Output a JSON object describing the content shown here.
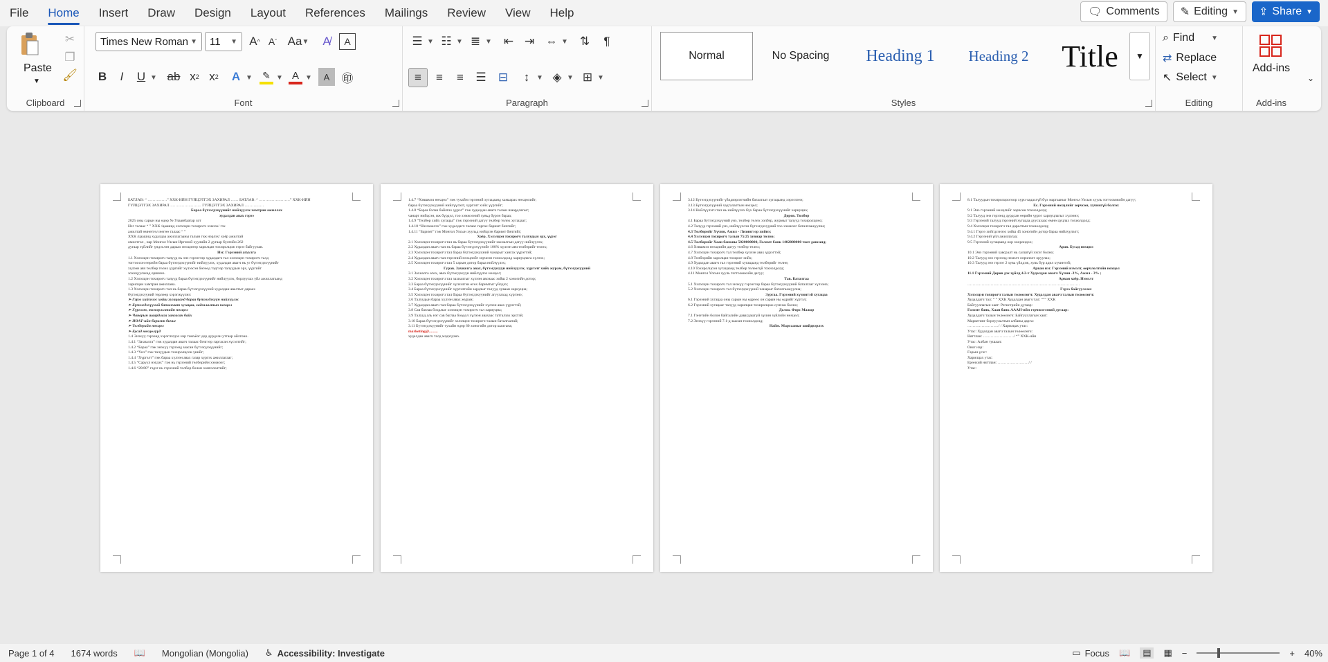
{
  "menu": [
    "File",
    "Home",
    "Insert",
    "Draw",
    "Design",
    "Layout",
    "References",
    "Mailings",
    "Review",
    "View",
    "Help"
  ],
  "active_menu": "Home",
  "top_right": {
    "comments": "Comments",
    "editing": "Editing",
    "share": "Share"
  },
  "ribbon": {
    "clipboard": {
      "label": "Clipboard",
      "paste": "Paste"
    },
    "font": {
      "label": "Font",
      "font_name": "Times New Roman",
      "font_size": "11"
    },
    "paragraph": {
      "label": "Paragraph"
    },
    "styles": {
      "label": "Styles",
      "items": [
        "Normal",
        "No Spacing",
        "Heading 1",
        "Heading 2",
        "Title"
      ]
    },
    "editing": {
      "label": "Editing",
      "find": "Find",
      "replace": "Replace",
      "select": "Select"
    },
    "addins": {
      "label": "Add-ins",
      "button": "Add-ins"
    }
  },
  "pages": [
    {
      "lines": [
        {
          "t": "БАТЛАВ: “ ……………” ХХК-ИЙН ГҮЙЦЭТГЭХ ЗАХИРАЛ ……          БАТЛАВ: “ ……………………” ХХК-ИЙН",
          "c": ""
        },
        {
          "t": "ГҮЙЦЭТГЭХ ЗАХИРАЛ ……………………          ГҮЙЦЭТГЭХ ЗАХИРАЛ ……………",
          "c": ""
        },
        {
          "t": " ",
          "c": ""
        },
        {
          "t": " ",
          "c": ""
        },
        {
          "t": " ",
          "c": ""
        },
        {
          "t": "Бараа бүтээгдэхүүнийг нийлүүлэх хамтран ажиллах",
          "c": "center"
        },
        {
          "t": "худалдан авах гэрээ",
          "c": "center"
        },
        {
          "t": " ",
          "c": ""
        },
        {
          "t": "2025 оны    сарын    ны өдөр                    №                    Улаанбаатар хот",
          "c": ""
        },
        {
          "t": " ",
          "c": ""
        },
        {
          "t": "Нэг талаас “          ” ХХК /цаашид хэлэлцэн тохирогч хэмээх/ гэх                  ",
          "c": ""
        },
        {
          "t": "ажилтай          өмнөтгөл          нөгөө талаас “                ”",
          "c": ""
        },
        {
          "t": "ХХК /цаашид худалдаа ажиллагааны талын гэж нэрлэх/ хоёр                    ажилтай",
          "c": ""
        },
        {
          "t": "өмнөтгөл ,          нар Монгол Улсын Иргэний хуулийн 2 дугаар бүлгийн 262",
          "c": ""
        },
        {
          "t": "дугаар зүйлийг үндэслэн дараах нөхцлөөр харилцан тохиролцож гэрээ байгуулав.",
          "c": ""
        },
        {
          "t": "Нэг. Гэрээний агуулга",
          "c": "center"
        },
        {
          "t": "1.1 Хэлэлцэн тохирогч талууд нь энэ гэрээгээр худалдагч тал хэлэлцэн тохирогч талд",
          "c": ""
        },
        {
          "t": "тогтоосон өөрийн бараа бүтээгдэхүүнийг нийлүүлэх, худалдан авагч нь уг бүтээгдэхүүнийг",
          "c": ""
        },
        {
          "t": "хүлээн авч төлбөр төлөх үүргийг хүлээсэн бөгөөд тэдгээр талуудын эрх, үүргийг",
          "c": ""
        },
        {
          "t": "зохицуулахад оршино.",
          "c": ""
        },
        {
          "t": "1.2 Хэлэлцэн тохирогч талууд бараа бүтээгдэхүүнийг нийлүүлэх, борлуулах үйл ажиллагаанд",
          "c": ""
        },
        {
          "t": "харилцан хамтран ажиллана.",
          "c": ""
        },
        {
          "t": "1.3 Хэлэлцэн тохирогч тал нь бараа бүтээгдэхүүний худалдан авалтыг дараах",
          "c": ""
        },
        {
          "t": "бүтээгдэхүүний төрлөөр хэрэгжүүлнэ:",
          "c": ""
        },
        {
          "t": "➢ Гэрээ хийснээс хойш хугацаанд бараа бүтээгдэхүүн нийлүүлэх",
          "c": "italic"
        },
        {
          "t": "➢ Бүтээгдэхүүний баталгаат хугацаа, хадгалалтын нөхцөл",
          "c": "italic"
        },
        {
          "t": "➢ Хүргэлт, тээвэрлэлтийн нөхцөл",
          "c": "italic"
        },
        {
          "t": "➢ Чанарын шаардлага хангасан байх",
          "c": "italic"
        },
        {
          "t": "➢ НӨАТ-ийн баримт бичиг",
          "c": "italic"
        },
        {
          "t": "➢ Төлбөрийн нөхцөл",
          "c": "italic"
        },
        {
          "t": "➢ Бусад нөхцөлүүд",
          "c": "italic"
        },
        {
          "t": "1.4 Энэхүү гэрээнд хэрэглэгдэх нэр томъёог дор дурдсан утгаар ойлгоно.",
          "c": ""
        },
        {
          "t": "1.4.1 “Захиалга” гэж худалдан авагч талаас бичгээр гаргасан хүсэлтийг;",
          "c": ""
        },
        {
          "t": "1.4.2 “Бараа” гэж энэхүү гэрээнд заасан бүтээгдэхүүнийг;",
          "c": ""
        },
        {
          "t": "1.4.3 “Үнэ” гэж талуудын тохиролцсон үнийг;",
          "c": ""
        },
        {
          "t": "1.4.4 “Хүргэлт” гэж бараа хүлээн авах газар хүргэх ажиллагааг;",
          "c": ""
        },
        {
          "t": "1.4.5 “Саруул нэгдэх” гэж нь гэрээний төлбөрийн хэмжээг;",
          "c": ""
        },
        {
          "t": "1.4.6 “20/80” гэдэг нь гэрээний төлбөр болон хөнгөлөлтийг;",
          "c": ""
        }
      ]
    },
    {
      "lines": [
        {
          "t": "1.4.7 “Хэвшмэл нөхцөл” гэж тухайн гэрээний хугацаанд хамаарах нөхцөлийг;",
          "c": ""
        },
        {
          "t": "бараа бүтээгдэхүүний нийлүүлэлт, хүргэлт хийх үүргийг;",
          "c": ""
        },
        {
          "t": "1.4.8 “Бараа бэлэн байлгах үүрэг” гэж худалдан авагч талын шаардлагыг;",
          "c": ""
        },
        {
          "t": "чанарт нийцсэн, иж бүрдэл, тоо хэмжээний хувьд бүрэн бараа;",
          "c": ""
        },
        {
          "t": "1.4.9 “Төлбөр хийх хугацаа” гэж гэрээний дагуу төлбөр төлөх хугацааг;",
          "c": ""
        },
        {
          "t": "1.4.10 “Нэхэмжлэх” гэж худалдагч талаас гаргах баримт бичгийг;",
          "c": ""
        },
        {
          "t": "1.4.11 “Баримт” гэж Монгол Улсын хуульд нийцсэн баримт бичгийг;",
          "c": ""
        },
        {
          "t": "Хоёр. Хэлэлцэн тохирогч талуудын эрх, үүрэг",
          "c": "center"
        },
        {
          "t": "2.1 Хэлэлцэн тохирогч тал нь бараа бүтээгдэхүүнийг захиалгын дагуу нийлүүлэх;",
          "c": ""
        },
        {
          "t": "2.2 Худалдан авагч тал нь бараа бүтээгдэхүүнийг 100% хүлээн авч төлбөрийг төлөх;",
          "c": ""
        },
        {
          "t": "2.3 Хэлэлцэн тохирогч тал бараа бүтээгдэхүүний чанарыг хангах үүрэгтэй;",
          "c": ""
        },
        {
          "t": "2.4 Худалдан авагч тал гэрээний нөхцлийг зөрчсөн тохиолдолд хариуцлага хүлээх;",
          "c": ""
        },
        {
          "t": "2.5 Хэлэлцэн тохирогч тал 5 сарын дотор бараа нийлүүлэх;",
          "c": ""
        },
        {
          "t": "Гурав. Захиалга авах, бүтээгдэхүүн нийлүүлэх, хүргэлт хийх журам, бүтээгдэхүүний",
          "c": "center"
        },
        {
          "t": "3.1 Захиалга өгөх, авах бүтээгдэхүүн нийлүүлэх нөхцөл;",
          "c": ""
        },
        {
          "t": "3.2 Хэлэлцэн тохирогч тал захиалгыг хүлээн авснаас хойш 2 хоногийн дотор;",
          "c": ""
        },
        {
          "t": "3.3 Бараа бүтээгдэхүүнийг хүлээлгэн өгөх баримтыг үйлдэх;",
          "c": ""
        },
        {
          "t": "3.4 Бараа бүтээгдэхүүнийг хүргэлтийн зардлыг талууд хуваан хариуцна;",
          "c": ""
        },
        {
          "t": "3.5 Хэлэлцэн тохирогч тал бараа бүтээгдэхүүнийг агуулахад хүргэнэ;",
          "c": ""
        },
        {
          "t": "3.6 Талуудын бараа хүлээн авах журам;",
          "c": ""
        },
        {
          "t": "3.7 Худалдан авагч тал бараа бүтээгдэхүүнийг хүлээн авах үүрэгтэй;",
          "c": ""
        },
        {
          "t": "3.8 Сав баглаа боодлыг хэлэлцэн тохирогч тал хариуцна;",
          "c": ""
        },
        {
          "t": "3.9 Талууд аль нэг сав баглаа боодол хүлээн авахаас татгалзах эрхтэй;",
          "c": ""
        },
        {
          "t": "3.10 Бараа бүтээгдэхүүнийг хэлэлцэн тохирогч талын баталгаатай;",
          "c": ""
        },
        {
          "t": "3.11 Бүтээгдэхүүнийг тухайн өдөр 60 хоногийн дотор шалгана;",
          "c": ""
        },
        {
          "t": "marketing@.........",
          "c": "red"
        },
        {
          "t": "худалдан авагч талд мэдэгдэнэ.",
          "c": ""
        }
      ]
    },
    {
      "lines": [
        {
          "t": "3.12 Бүтээгдэхүүнийг үйлдвэрлэгчийн баталгаат хугацаанд хэрэглэнэ;",
          "c": ""
        },
        {
          "t": "3.13 Бүтээгдэхүүний хадгалалтын нөхцөл;",
          "c": ""
        },
        {
          "t": "3.14 Нийлүүлэгч тал нь нийлүүлэх бүх бараа бүтээгдэхүүнийг хариуцна;",
          "c": ""
        },
        {
          "t": "Дөрөв. Төлбөр",
          "c": "center"
        },
        {
          "t": "4.1 Бараа бүтээгдэхүүний үнэ, төлбөр төлөх хэлбэр, журмыг талууд тохиролцоно;",
          "c": ""
        },
        {
          "t": "4.2 Талууд гэрээний үнэ, нийлүүлсэн бүтээгдэхүүний тоо хэмжээг баталгаажуулна;",
          "c": ""
        },
        {
          "t": "4.3 Төлбөрийг Хүчин, Ажил - Лизингээр хийнэ;",
          "c": "bold"
        },
        {
          "t": "4.4 Хэлэлцэн тохирогч талын 75/25 хувиар төлнө;",
          "c": "bold"
        },
        {
          "t": "4.5 Төлбөрийг Хаан банкны 5020000000, Голомт банк 1402000000 тоот дансанд;",
          "c": "bold"
        },
        {
          "t": "4.6 Хэвшмэл нөхцлийн дагуу төлбөр төлөх;",
          "c": ""
        },
        {
          "t": "4.7 Хэлэлцэн тохирогч тал төлбөр хүлээн авах үүрэгтэй;",
          "c": ""
        },
        {
          "t": "4.8 Төлбөрийн харилцан тооцоог хийх;",
          "c": ""
        },
        {
          "t": "4.9 Худалдан авагч тал гэрээний хугацаанд төлбөрийг төлнө;",
          "c": ""
        },
        {
          "t": "4.10 Тохиролцсон хугацаанд төлбөр төлөөгүй тохиолдолд;",
          "c": ""
        },
        {
          "t": "4.11 Монгол Улсын хууль тогтоомжийн дагуу;",
          "c": ""
        },
        {
          "t": "Тав. Баталгаа",
          "c": "center"
        },
        {
          "t": "5.1 Хэлэлцэн тохирогч тал энэхүү гэрээгээр бараа бүтээгдэхүүний баталгааг хүлээнэ;",
          "c": ""
        },
        {
          "t": "5.2 Хэлэлцэн тохирогч тал бүтээгдэхүүний чанарыг баталгаажуулна;",
          "c": ""
        },
        {
          "t": "Зургаа. Гэрээний хүчинтэй хугацаа",
          "c": "center"
        },
        {
          "t": "6.1 Гэрээний хугацаа    оны    сарын    ны өдрөөс    он    сарын    ны өдрийг хүртэл;",
          "c": ""
        },
        {
          "t": "6.2 Гэрээний хугацааг талууд харилцан тохиролцож сунгаж болно;",
          "c": ""
        },
        {
          "t": "Долоо. Форс Мажор",
          "c": "center"
        },
        {
          "t": "7.1 Гэнэтийн болон байгалийн давагдашгүй хүчин зүйлийн нөхцөл;",
          "c": ""
        },
        {
          "t": "7.2 Энэхүү гэрээний 7.1-д заасан тохиолдолд;",
          "c": ""
        },
        {
          "t": "Найм. Маргааныг шийдвэрлэх",
          "c": "center"
        }
      ]
    },
    {
      "lines": [
        {
          "t": "8.1 Талуудын тохиролцоогоор хүрч чадахгүй бүх маргааныг Монгол Улсын хууль тогтоомжийн дагуу;",
          "c": ""
        },
        {
          "t": "Ес. Гэрээний нөхцлийг зөрчсөн, хүчингүй болгох",
          "c": "center"
        },
        {
          "t": "9.1 Энэ гэрээний нөхцлийг зөрчсөн тохиолдолд;",
          "c": ""
        },
        {
          "t": "9.2 Талууд энэ гэрээнд дурдсан өөрийн үүрэг хариуцлагыг хүлээнэ;",
          "c": ""
        },
        {
          "t": "9.3 Гэрээний талууд гэрээний хугацаа дуусахаас өмнө цуцлах тохиолдолд;",
          "c": ""
        },
        {
          "t": "9.4 Хэлэлцэн тохирогч тал даралтын тохиолдолд;",
          "c": ""
        },
        {
          "t": "9.4.1 Гэрээ хийгдсэнээс хойш 45 хоногийн дотор бараа нийлүүлэлт;",
          "c": ""
        },
        {
          "t": "9.4.2 Гэрээний үйл ажиллагаа;",
          "c": ""
        },
        {
          "t": "9.5 Гэрээний хугацаанд өөр хоорондоо;",
          "c": ""
        },
        {
          "t": "Арав. Бусад нөхцөл",
          "c": "center"
        },
        {
          "t": "10.1 Энэ гэрээний хавсралт нь салшгүй хэсэг болно;",
          "c": ""
        },
        {
          "t": "10.2 Талууд энэ гэрээнд нэмэлт өөрчлөлт оруулах;",
          "c": ""
        },
        {
          "t": "10.3 Талууд энэ гэрээг 2 хувь үйлдэж, хувь бүр адил хүчинтэй;",
          "c": ""
        },
        {
          "t": "Арван нэг. Гэрээний нэмэлт, өөрчлөлтийн нөхцөл",
          "c": "center"
        },
        {
          "t": "11.1 Гэрээний Дөрөв дэх зүйлд 4.2-т Худалдан авагч Хүчин -3%, Ажил - 3% ;",
          "c": "bold"
        },
        {
          "t": "Арван хоёр. Нэмэлт",
          "c": "center"
        },
        {
          "t": "……………………………………………………………………………",
          "c": ""
        },
        {
          "t": " ",
          "c": ""
        },
        {
          "t": "Гэрээ байгуулсан:",
          "c": "center"
        },
        {
          "t": " ",
          "c": ""
        },
        {
          "t": "Хэлэлцэн тохирогч талын төлөөлөгч:          Худалдан авагч талын төлөөлөгч:",
          "c": "bold"
        },
        {
          "t": "Худалдагч тал: “        ” ХХК               Худалдан авагч тал: “”” ХХК",
          "c": ""
        },
        {
          "t": "Байгууллагын хаяг:                          Регистрийн дугаар:",
          "c": ""
        },
        {
          "t": "Голомт банк, Хаан банк                      АААН-ийн гэрчилгээний дугаар:",
          "c": "bold"
        },
        {
          "t": "Худалдагч талын төлөөлөгч:                  Байгууллагын хаяг:",
          "c": ""
        },
        {
          "t": "Маркетинг борлуулалтын албаны дарга:",
          "c": ""
        },
        {
          "t": "……………………/              /           Харилцах утас:",
          "c": ""
        },
        {
          "t": "Утас:                                        Худалдан авагч талын төлөөлөгч:",
          "c": ""
        },
        {
          "t": "Нягтлан: ……………………/                    “” ХХК-ийн",
          "c": ""
        },
        {
          "t": "Утас:                                        Албан тушаал:",
          "c": ""
        },
        {
          "t": "                                              Овог нэр:",
          "c": ""
        },
        {
          "t": "                                              Гарын үсэг:",
          "c": ""
        },
        {
          "t": "                                              Харилцах утас:",
          "c": ""
        },
        {
          "t": "                                              Ерөнхий нягтлан: ……………………/      /",
          "c": ""
        },
        {
          "t": "                                              Утас:",
          "c": ""
        }
      ]
    }
  ],
  "status": {
    "page": "Page 1 of 4",
    "words": "1674 words",
    "language": "Mongolian (Mongolia)",
    "accessibility": "Accessibility: Investigate",
    "focus": "Focus",
    "zoom": "40%"
  }
}
